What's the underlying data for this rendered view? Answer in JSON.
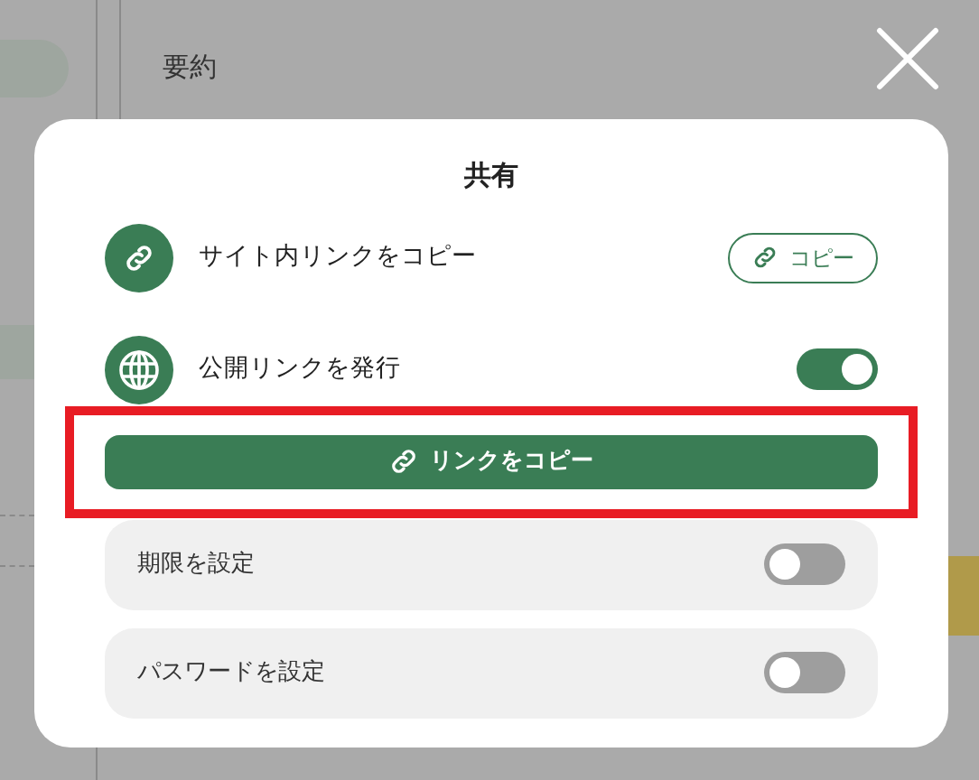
{
  "background": {
    "heading": "要約"
  },
  "dialog": {
    "title": "共有",
    "share_rows": [
      {
        "kind": "copy",
        "label": "サイト内リンクをコピー",
        "button": "コピー"
      },
      {
        "kind": "toggle",
        "label": "公開リンクを発行",
        "on": true
      }
    ],
    "copy_link_button": {
      "label": "リンクをコピー",
      "highlighted": true
    },
    "settings": [
      {
        "label": "期限を設定",
        "on": false
      },
      {
        "label": "パスワードを設定",
        "on": false
      }
    ]
  }
}
